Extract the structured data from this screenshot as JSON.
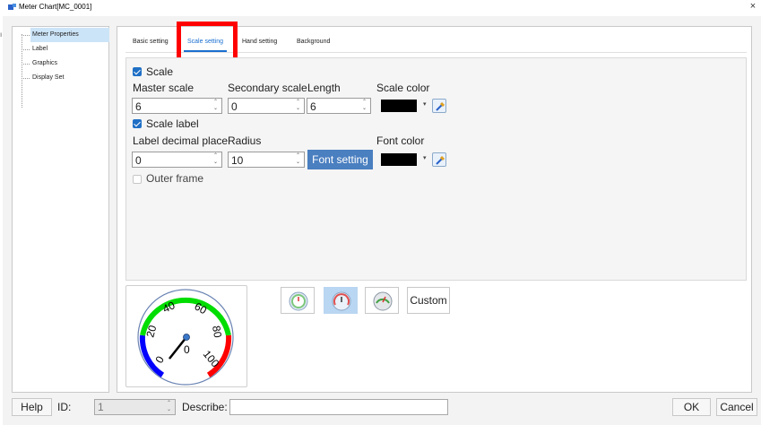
{
  "window": {
    "title": "Meter Chart[MC_0001]",
    "close_glyph": "×",
    "edge_glyph": "ı"
  },
  "sidebar": {
    "items": [
      {
        "label": "Meter Properties",
        "selected": true
      },
      {
        "label": "Label",
        "selected": false
      },
      {
        "label": "Graphics",
        "selected": false
      },
      {
        "label": "Display Set",
        "selected": false
      }
    ]
  },
  "tabs": [
    {
      "label": "Basic setting",
      "active": false
    },
    {
      "label": "Scale setting",
      "active": true
    },
    {
      "label": "Hand setting",
      "active": false
    },
    {
      "label": "Background",
      "active": false
    }
  ],
  "scale_setting": {
    "scale_checkbox": {
      "label": "Scale",
      "checked": true
    },
    "master_scale": {
      "label": "Master scale",
      "value": "6"
    },
    "secondary_scale": {
      "label": "Secondary scale",
      "value": "0"
    },
    "length": {
      "label": "Length",
      "value": "6"
    },
    "scale_color": {
      "label": "Scale color",
      "color": "#000000"
    },
    "scale_label_checkbox": {
      "label": "Scale label",
      "checked": true
    },
    "label_decimal_place": {
      "label": "Label decimal place",
      "value": "0"
    },
    "radius": {
      "label": "Radius",
      "value": "10"
    },
    "font_setting_button": "Font setting",
    "font_color": {
      "label": "Font color",
      "color": "#000000"
    },
    "outer_frame_checkbox": {
      "label": "Outer frame",
      "checked": false
    }
  },
  "preview": {
    "tick_labels": [
      "0",
      "20",
      "40",
      "60",
      "80",
      "100"
    ],
    "needle_value": "0",
    "arc_colors": {
      "low": "#0000ff",
      "mid": "#00dd00",
      "high": "#ff0000"
    }
  },
  "meter_styles": {
    "selected_index": 1,
    "custom_label": "Custom"
  },
  "footer": {
    "help": "Help",
    "id_label": "ID:",
    "id_value": "1",
    "describe_label": "Describe:",
    "describe_value": "",
    "ok": "OK",
    "cancel": "Cancel"
  },
  "colors": {
    "accent": "#1a6fd0",
    "highlight_box": "#ff0000",
    "font_button": "#4a7fc0",
    "selected_item": "#cce4f7"
  },
  "spinner_arrows": "⌃⌄"
}
